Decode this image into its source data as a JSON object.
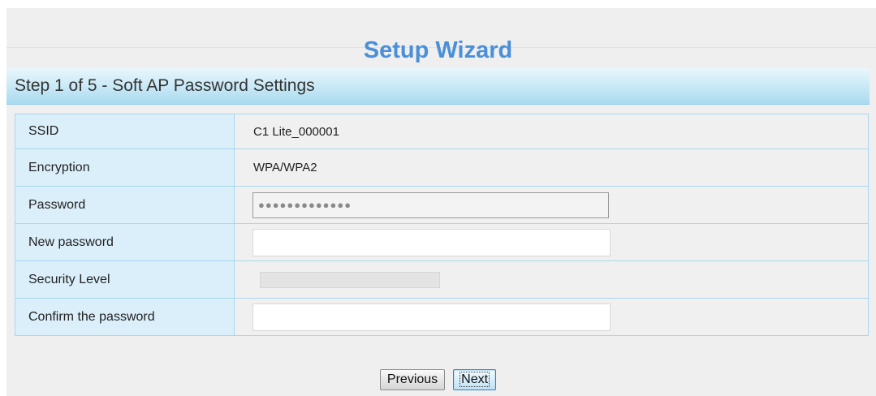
{
  "wizard": {
    "title": "Setup Wizard",
    "step_title": "Step 1 of 5 - Soft AP Password Settings"
  },
  "fields": {
    "ssid": {
      "label": "SSID",
      "value": "C1 Lite_000001"
    },
    "encryption": {
      "label": "Encryption",
      "value": "WPA/WPA2"
    },
    "password": {
      "label": "Password",
      "value": "●●●●●●●●●●●●●"
    },
    "new_password": {
      "label": "New password",
      "value": ""
    },
    "security_level": {
      "label": "Security Level",
      "level": 0
    },
    "confirm_password": {
      "label": "Confirm the password",
      "value": ""
    }
  },
  "buttons": {
    "previous_label": "Previous",
    "next_label": "Next"
  },
  "colors": {
    "title": "#4a8fd8",
    "step_bar": "#cdebf7",
    "label_cell": "#dbeffa",
    "table_border": "#a9d6ee"
  }
}
